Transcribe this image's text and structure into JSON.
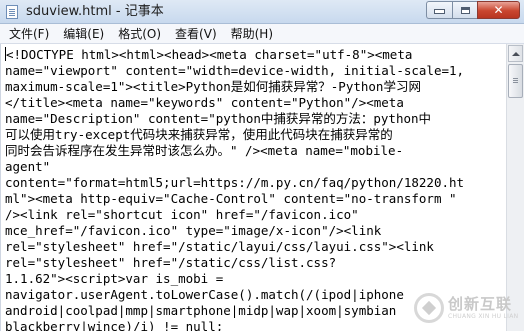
{
  "window": {
    "title": "sduview.html - 记事本",
    "icon": "notepad-icon",
    "controls": {
      "minimize": "minimize-icon",
      "maximize": "maximize-icon",
      "close": "close-icon"
    }
  },
  "menu": [
    "文件(F)",
    "编辑(E)",
    "格式(O)",
    "查看(V)",
    "帮助(H)"
  ],
  "editor": {
    "lines": [
      "<!DOCTYPE html><html><head><meta charset=\"utf-8\"><meta",
      "name=\"viewport\" content=\"width=device-width, initial-scale=1,",
      "maximum-scale=1\"><title>Python是如何捕获异常？-Python学习网",
      "</title><meta name=\"keywords\" content=\"Python\"/><meta",
      "name=\"Description\" content=\"python中捕获异常的方法：python中",
      "可以使用try-except代码块来捕获异常，使用此代码块在捕获异常的",
      "同时会告诉程序在发生异常时该怎么办。\" /><meta name=\"mobile-",
      "agent\"",
      "content=\"format=html5;url=https://m.py.cn/faq/python/18220.ht",
      "ml\"><meta http-equiv=\"Cache-Control\" content=\"no-transform \"",
      "/><link rel=\"shortcut icon\" href=\"/favicon.ico\"",
      "mce_href=\"/favicon.ico\" type=\"image/x-icon\"/><link",
      "rel=\"stylesheet\" href=\"/static/layui/css/layui.css\"><link",
      "rel=\"stylesheet\" href=\"/static/css/list.css?",
      "1.1.62\"><script>var is_mobi =",
      "navigator.userAgent.toLowerCase().match(/(ipod|iphone",
      "android|coolpad|mmp|smartphone|midp|wap|xoom|symbian",
      "blackberry|wince)/i) != null;"
    ]
  },
  "watermark": {
    "logo": "chuangxin-logo-icon",
    "text_cn": "创新互联",
    "text_en": "CHUANG XIN HU LIAN"
  }
}
